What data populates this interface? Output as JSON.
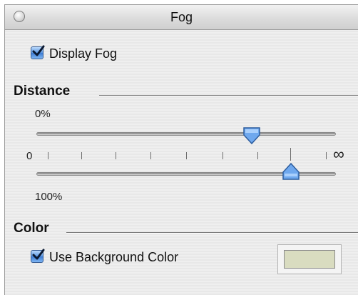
{
  "window": {
    "title": "Fog"
  },
  "display_fog": {
    "label": "Display Fog",
    "checked": true
  },
  "distance": {
    "section_title": "Distance",
    "top_value_label": "0%",
    "bottom_value_label": "100%",
    "scale_min_label": "0",
    "scale_max_label": "∞",
    "start_thumb_fraction": 0.72,
    "end_thumb_fraction": 0.85
  },
  "color": {
    "section_title": "Color",
    "use_background_label": "Use Background Color",
    "use_background_checked": true,
    "swatch_color": "#d9dcc0"
  },
  "colors": {
    "accent": "#3a7ad2",
    "thumb": "#6fa8ee"
  }
}
